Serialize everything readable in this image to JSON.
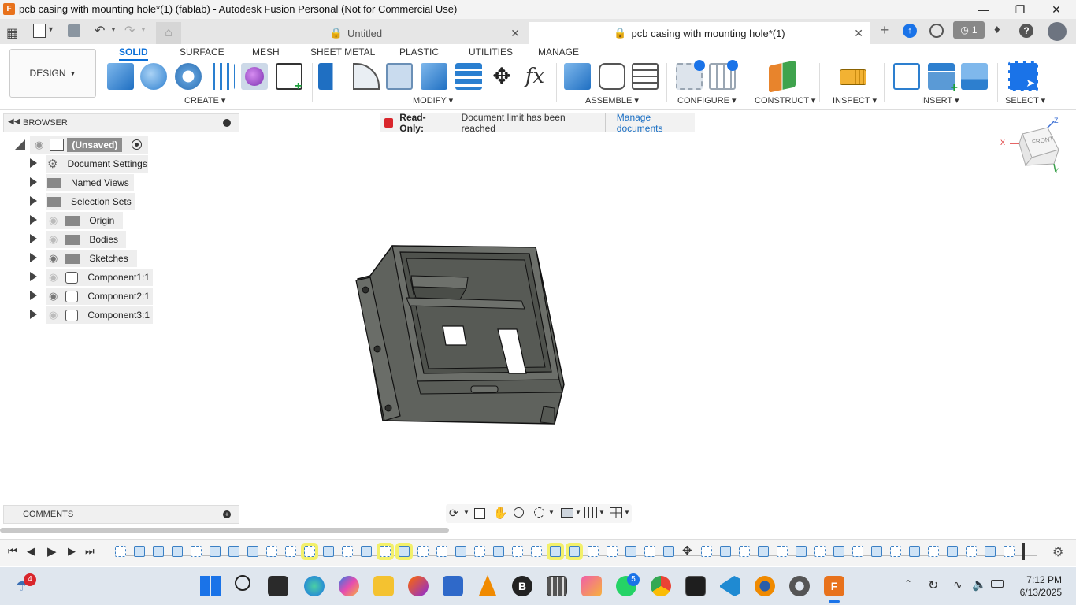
{
  "window": {
    "title": "pcb casing with mounting hole*(1) (fablab) - Autodesk Fusion Personal (Not for Commercial Use)"
  },
  "tabs": [
    {
      "label": "Untitled",
      "active": false
    },
    {
      "label": "pcb casing with mounting hole*(1)",
      "active": true
    }
  ],
  "header": {
    "job_count": "1"
  },
  "toolbar": {
    "workspace": "DESIGN",
    "tabs": [
      "SOLID",
      "SURFACE",
      "MESH",
      "SHEET METAL",
      "PLASTIC",
      "UTILITIES",
      "MANAGE"
    ],
    "groups": [
      "CREATE",
      "MODIFY",
      "ASSEMBLE",
      "CONFIGURE",
      "CONSTRUCT",
      "INSPECT",
      "INSERT",
      "SELECT"
    ]
  },
  "browser": {
    "title": "BROWSER",
    "root": "(Unsaved)",
    "items": [
      {
        "label": "Document Settings",
        "icon": "gear-icon"
      },
      {
        "label": "Named Views",
        "icon": "folder-icon"
      },
      {
        "label": "Selection Sets",
        "icon": "folder-icon"
      },
      {
        "label": "Origin",
        "icon": "folder-icon",
        "visibility": "hidden"
      },
      {
        "label": "Bodies",
        "icon": "folder-icon",
        "visibility": "hidden"
      },
      {
        "label": "Sketches",
        "icon": "folder-icon",
        "visibility": "visible"
      },
      {
        "label": "Component1:1",
        "icon": "component-icon",
        "visibility": "hidden"
      },
      {
        "label": "Component2:1",
        "icon": "component-icon",
        "visibility": "visible"
      },
      {
        "label": "Component3:1",
        "icon": "component-icon",
        "visibility": "hidden"
      }
    ]
  },
  "notice": {
    "label": "Read-Only:",
    "message": "Document limit has been reached",
    "link": "Manage documents"
  },
  "comments": {
    "title": "COMMENTS"
  },
  "viewcube": {
    "face": "FRONT",
    "axis_x": "X",
    "axis_z": "Z",
    "axis_y": "Y"
  },
  "taskbar": {
    "weather_badge": "4",
    "whatsapp_badge": "5",
    "time": "7:12 PM",
    "date": "6/13/2025"
  },
  "colors": {
    "accent": "#0a6fd8",
    "model": "#5f625d",
    "highlight": "#f3f06a"
  }
}
